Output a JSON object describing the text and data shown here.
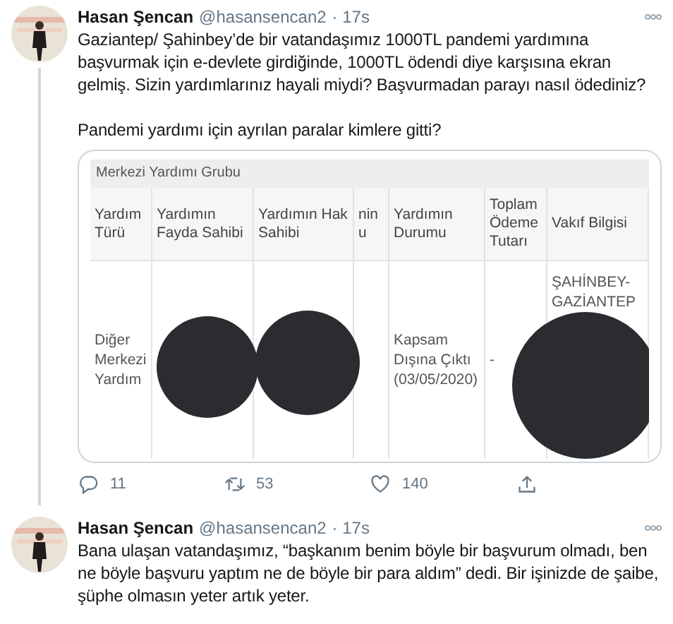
{
  "tweets": [
    {
      "name": "Hasan Şencan",
      "handle": "@hasansencan2",
      "time": "· 17s",
      "threaded": true,
      "paragraphs": [
        "Gaziantep/ Şahinbey’de bir vatandaşımız 1000TL pandemi yardımına başvurmak için e-devlete girdiğinde, 1000TL ödendi diye karşısına ekran gelmiş. Sizin yardımlarınız hayali miydi? Başvurmadan parayı nasıl ödediniz?",
        "Pandemi yardımı için ayrılan paralar kimlere gitti?"
      ],
      "embed": {
        "group_title": "Merkezi Yardımı Grubu",
        "columns": [
          "Yardım Türü",
          "Yardımın Fayda Sahibi",
          "Yardımın Hak Sahibi",
          "nin u",
          "Yardımın Durumu",
          "Toplam Ödeme Tutarı",
          "Vakıf Bilgisi"
        ],
        "row": [
          {
            "text": "Diğer Merkezi Yardım",
            "redacted": false
          },
          {
            "redacted": true
          },
          {
            "redacted": true
          },
          {
            "redacted": false
          },
          {
            "text": "Kapsam Dışına Çıktı (03/05/2020)",
            "redacted": false
          },
          {
            "text": "-",
            "redacted": false
          },
          {
            "text": "ŞAHİNBEY-GAZİANTEP",
            "redacted": true
          }
        ]
      },
      "actions": [
        {
          "kind": "reply",
          "count": "11"
        },
        {
          "kind": "retweet",
          "count": "53"
        },
        {
          "kind": "like",
          "count": "140"
        },
        {
          "kind": "share"
        }
      ]
    },
    {
      "name": "Hasan Şencan",
      "handle": "@hasansencan2",
      "time": "· 17s",
      "threaded": false,
      "paragraphs": [
        "Bana ulaşan vatandaşımız, “başkanım benim böyle bir başvurum olmadı, ben ne böyle başvuru yaptım ne de böyle bir para aldım” dedi.  Bir işinizde de şaibe, şüphe olmasın yeter artık yeter."
      ]
    }
  ]
}
